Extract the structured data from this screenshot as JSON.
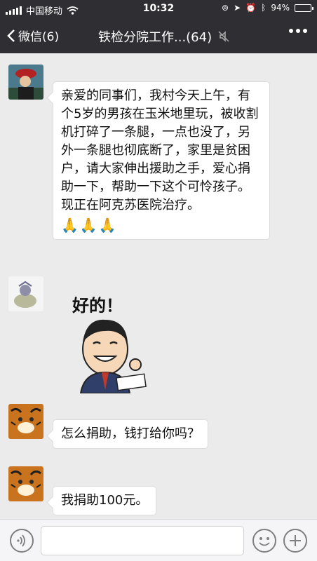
{
  "status_bar": {
    "carrier": "中国移动",
    "time": "10:32",
    "battery": "94%",
    "battery_level": 0.94
  },
  "nav": {
    "back_label": "微信(6)",
    "title": "铁检分院工作...(64)"
  },
  "messages": [
    {
      "text": "亲爱的同事们，我村今天上午，有个5岁的男孩在玉米地里玩，被收割机打碎了一条腿，一点也没了，另外一条腿也彻底断了，家里是贫困户，请大家伸出援助之手，爱心捐助一下，帮助一下这个可怜孩子。现正在阿克苏医院治疗。",
      "emoji": "🙏🙏🙏"
    },
    {
      "sticker_text": "好的！"
    },
    {
      "text": "怎么捐助，钱打给你吗？"
    },
    {
      "text": "我捐助100元。"
    }
  ],
  "colors": {
    "nav_bg": "#2e2e33",
    "chat_bg": "#ebebeb",
    "bubble": "#ffffff"
  }
}
